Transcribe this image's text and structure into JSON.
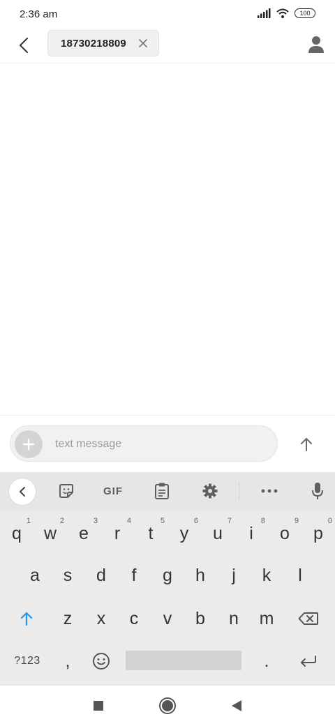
{
  "status_bar": {
    "time": "2:36 am",
    "battery": "100",
    "icons": [
      "signal-icon",
      "wifi-icon",
      "battery-icon"
    ]
  },
  "header": {
    "recipient": "18730218809",
    "icons": [
      "back-arrow-icon",
      "close-icon",
      "contact-person-icon"
    ]
  },
  "compose": {
    "placeholder": "text message",
    "value": "",
    "icons": [
      "plus-icon",
      "send-arrow-icon"
    ]
  },
  "keyboard": {
    "toolbar": {
      "gif_label": "GIF",
      "icons": [
        "chevron-left-icon",
        "sticker-icon",
        "clipboard-icon",
        "gear-icon",
        "more-dots-icon",
        "microphone-icon"
      ]
    },
    "row1": [
      {
        "key": "q",
        "hint": "1"
      },
      {
        "key": "w",
        "hint": "2"
      },
      {
        "key": "e",
        "hint": "3"
      },
      {
        "key": "r",
        "hint": "4"
      },
      {
        "key": "t",
        "hint": "5"
      },
      {
        "key": "y",
        "hint": "6"
      },
      {
        "key": "u",
        "hint": "7"
      },
      {
        "key": "i",
        "hint": "8"
      },
      {
        "key": "o",
        "hint": "9"
      },
      {
        "key": "p",
        "hint": "0"
      }
    ],
    "row2": [
      "a",
      "s",
      "d",
      "f",
      "g",
      "h",
      "j",
      "k",
      "l"
    ],
    "row3": [
      "z",
      "x",
      "c",
      "v",
      "b",
      "n",
      "m"
    ],
    "row4": {
      "symbols_label": "?123",
      "comma": ",",
      "period": "."
    },
    "icons": [
      "shift-arrow-icon",
      "backspace-icon",
      "emoji-icon",
      "enter-icon"
    ]
  },
  "nav_bar": {
    "icons": [
      "recents-square-icon",
      "home-circle-icon",
      "back-triangle-icon"
    ]
  },
  "colors": {
    "accent_blue": "#2196f3",
    "icon_gray": "#555555",
    "keyboard_bg": "#ebebeb"
  }
}
